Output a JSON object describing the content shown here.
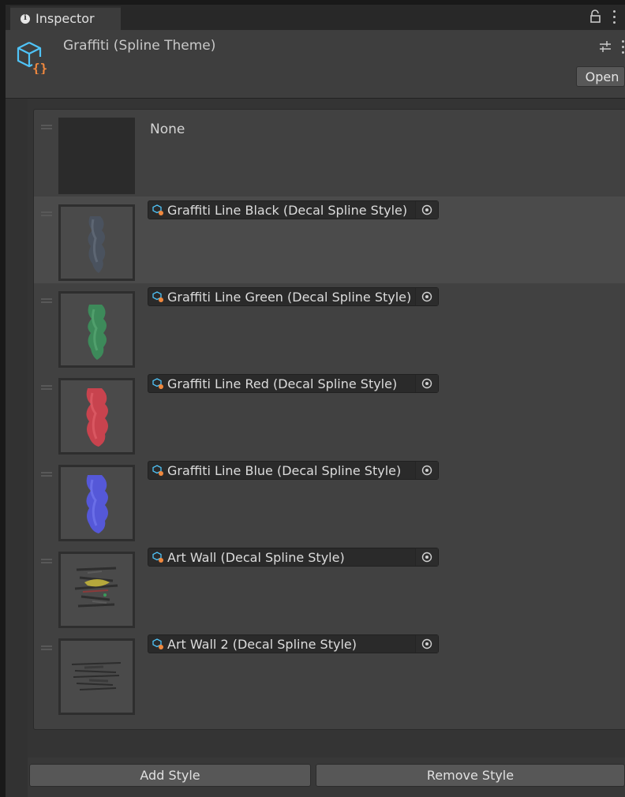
{
  "tab": {
    "label": "Inspector"
  },
  "header": {
    "title": "Graffiti (Spline Theme)",
    "open_label": "Open"
  },
  "colors": {
    "accent_cyan": "#4fc3f7",
    "accent_orange": "#f0883e"
  },
  "styles": {
    "none_label": "None",
    "items": [
      {
        "label": "Graffiti Line Black (Decal Spline Style)",
        "thumb": "black"
      },
      {
        "label": "Graffiti Line Green (Decal Spline Style)",
        "thumb": "green"
      },
      {
        "label": "Graffiti Line Red (Decal Spline Style)",
        "thumb": "red"
      },
      {
        "label": "Graffiti Line Blue (Decal Spline Style)",
        "thumb": "blue"
      },
      {
        "label": "Art Wall (Decal Spline Style)",
        "thumb": "artwall"
      },
      {
        "label": "Art Wall 2 (Decal Spline Style)",
        "thumb": "artwall2"
      }
    ]
  },
  "footer": {
    "add_label": "Add Style",
    "remove_label": "Remove Style"
  }
}
